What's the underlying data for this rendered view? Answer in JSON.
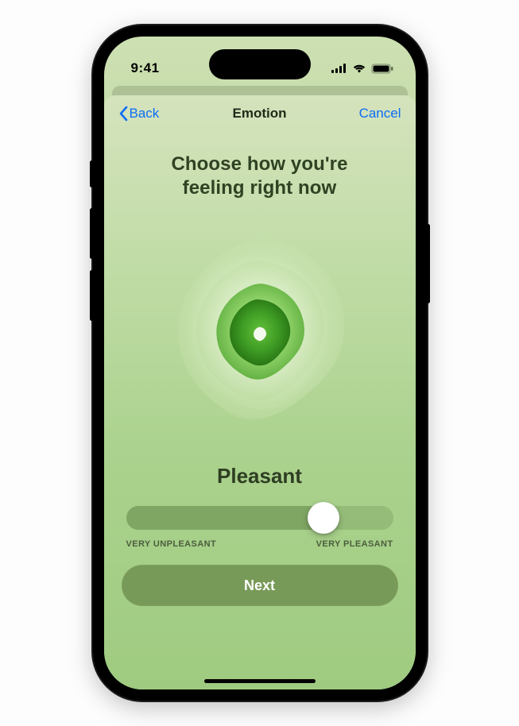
{
  "status": {
    "time": "9:41"
  },
  "nav": {
    "back_label": "Back",
    "title": "Emotion",
    "cancel_label": "Cancel"
  },
  "headline": "Choose how you're\nfeeling right now",
  "emotion_label": "Pleasant",
  "slider": {
    "min_label": "VERY UNPLEASANT",
    "max_label": "VERY PLEASANT",
    "value_pct": 74
  },
  "next_label": "Next",
  "colors": {
    "accent_link": "#0b6df6",
    "button_bg": "#789a58",
    "text_dark": "#2f4222"
  }
}
